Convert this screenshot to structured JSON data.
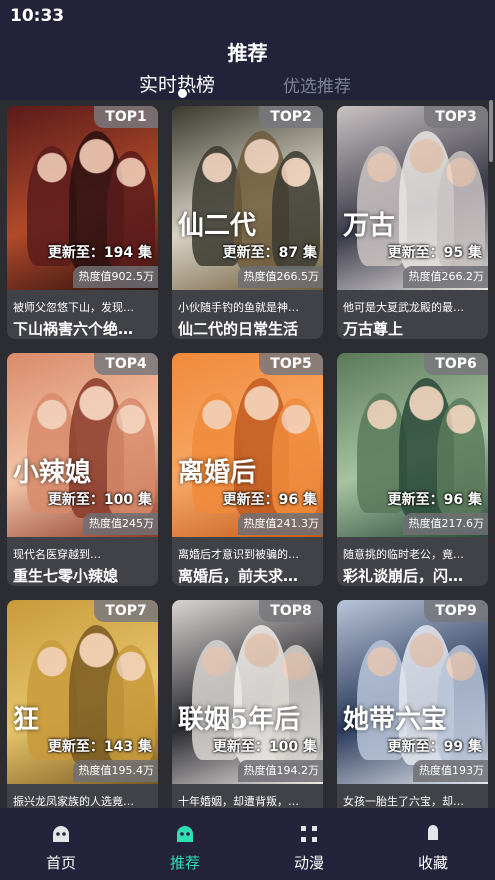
{
  "status_bar": {
    "time": "10:33"
  },
  "header": {
    "title": "推荐",
    "tabs": [
      {
        "label": "实时热榜",
        "active": true
      },
      {
        "label": "优选推荐",
        "active": false
      }
    ]
  },
  "cards": [
    {
      "rank": "TOP1",
      "episodes": "更新至：194 集",
      "heat": "热度值902.5万",
      "desc": "被师父忽悠下山，发现…",
      "title": "下山祸害六个绝…",
      "poster_text": "",
      "colors": [
        "#5a1b1b",
        "#b24a2a",
        "#2a1010"
      ]
    },
    {
      "rank": "TOP2",
      "episodes": "更新至：87 集",
      "heat": "热度值266.5万",
      "desc": "小伙随手钓的鱼就是神…",
      "title": "仙二代的日常生活",
      "poster_text": "仙二代",
      "colors": [
        "#3b3a30",
        "#d8d2c4",
        "#6e5a3a"
      ]
    },
    {
      "rank": "TOP3",
      "episodes": "更新至：95 集",
      "heat": "热度值266.2万",
      "desc": "他可是大夏武龙殿的最…",
      "title": "万古尊上",
      "poster_text": "万古",
      "colors": [
        "#c9c2c2",
        "#3a3a48",
        "#eae6e4"
      ]
    },
    {
      "rank": "TOP4",
      "episodes": "更新至：100 集",
      "heat": "热度值245万",
      "desc": "现代名医穿越到…",
      "title": "重生七零小辣媳",
      "poster_text": "小辣媳",
      "colors": [
        "#d88a6a",
        "#f4c6a8",
        "#8a3a2a"
      ]
    },
    {
      "rank": "TOP5",
      "episodes": "更新至：96 集",
      "heat": "热度值241.3万",
      "desc": "离婚后才意识到被骗的…",
      "title": "离婚后，前夫求…",
      "poster_text": "离婚后",
      "colors": [
        "#f08a3a",
        "#f6a866",
        "#c25a20"
      ]
    },
    {
      "rank": "TOP6",
      "episodes": "更新至：96 集",
      "heat": "热度值217.6万",
      "desc": "随意挑的临时老公，竟…",
      "title": "彩礼谈崩后，闪…",
      "poster_text": "",
      "colors": [
        "#5a7a5a",
        "#a6c2a0",
        "#2a4a3a"
      ]
    },
    {
      "rank": "TOP7",
      "episodes": "更新至：143 集",
      "heat": "热度值195.4万",
      "desc": "振兴龙凤家族的人选竟…",
      "title": "",
      "poster_text": "狂",
      "colors": [
        "#c89a3a",
        "#e6c46a",
        "#7a5a20"
      ]
    },
    {
      "rank": "TOP8",
      "episodes": "更新至：100 集",
      "heat": "热度值194.2万",
      "desc": "十年婚姻，却遭背叛，…",
      "title": "",
      "poster_text": "联姻5年后",
      "colors": [
        "#d8d4d0",
        "#2a2a30",
        "#f0ece8"
      ]
    },
    {
      "rank": "TOP9",
      "episodes": "更新至：99 集",
      "heat": "热度值193万",
      "desc": "女孩一胎生了六宝，却…",
      "title": "",
      "poster_text": "她带六宝",
      "colors": [
        "#b8c4d8",
        "#2a3a5a",
        "#e4e8f0"
      ]
    }
  ],
  "bottom_nav": [
    {
      "label": "首页",
      "icon": "ghost-icon",
      "active": false
    },
    {
      "label": "推荐",
      "icon": "ghost-icon",
      "active": true
    },
    {
      "label": "动漫",
      "icon": "grid-corners-icon",
      "active": false
    },
    {
      "label": "收藏",
      "icon": "bookmark-icon",
      "active": false
    }
  ],
  "accent_color": "#2fe0b4"
}
